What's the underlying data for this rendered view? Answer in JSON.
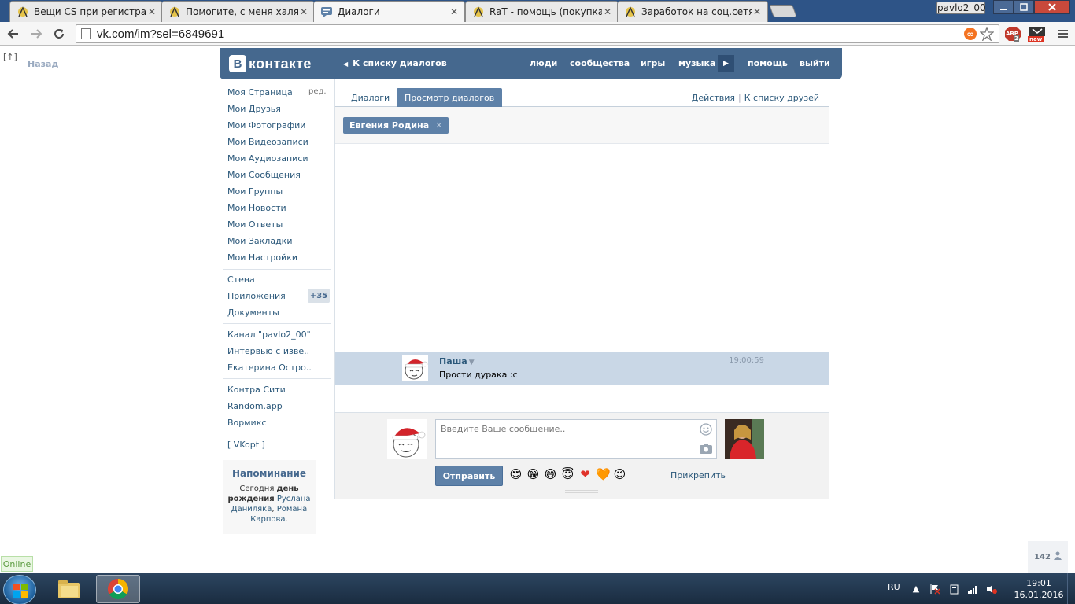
{
  "browser": {
    "tabs": [
      {
        "title": "Вещи CS при регистраци",
        "active": false
      },
      {
        "title": "Помогите, с меня халява",
        "active": false
      },
      {
        "title": "Диалоги",
        "active": true
      },
      {
        "title": "RaT - помощь (покупка-о",
        "active": false
      },
      {
        "title": "Заработок на соц.сетях и",
        "active": false
      }
    ],
    "close_glyph": "✕",
    "profile_name": "pavlo2_00",
    "url": "vk.com/im?sel=6849691",
    "extensions": {
      "abp_label": "ABP",
      "abp_count": "2",
      "new_label": "new"
    }
  },
  "vk": {
    "logo_letter": "В",
    "logo_text": "контакте",
    "back_to_list": "К списку диалогов",
    "topnav": [
      "люди",
      "сообщества",
      "игры",
      "музыка",
      "помощь",
      "выйти"
    ],
    "up_arrow": "[↑]",
    "back_label": "Назад",
    "left_menu": {
      "edit_label": "ред.",
      "group1": [
        "Моя Страница",
        "Мои Друзья",
        "Мои Фотографии",
        "Мои Видеозаписи",
        "Мои Аудиозаписи",
        "Мои Сообщения",
        "Мои Группы",
        "Мои Новости",
        "Мои Ответы",
        "Мои Закладки",
        "Мои Настройки"
      ],
      "group2": [
        "Стена",
        "Приложения",
        "Документы"
      ],
      "apps_badge": "+35",
      "group3": [
        "Канал \"pavlo2_00\"",
        "Интервью с изве..",
        "Екатерина Остро.."
      ],
      "group4": [
        "Контра Сити",
        "Random.app",
        "Вормикс"
      ],
      "group5": [
        "[ VKopt ]"
      ]
    },
    "reminder": {
      "title": "Напоминание",
      "text_today": "Сегодня",
      "text_bold": "день рождения",
      "name1": "Руслана Даниляка",
      "comma": ",",
      "name2": "Романа Карпова",
      "dot": "."
    },
    "tabs": {
      "dialogs": "Диалоги",
      "view": "Просмотр диалогов"
    },
    "actions": {
      "actions": "Действия",
      "sep": "|",
      "to_friends": "К списку друзей"
    },
    "peer_chip": {
      "name": "Евгения Родина",
      "close": "✕"
    },
    "message": {
      "author": "Паша",
      "arrow": "▼",
      "text": "Прости дурака :c",
      "time": "19:00:59"
    },
    "composer": {
      "placeholder": "Введите Ваше сообщение..",
      "send": "Отправить",
      "emoji": [
        "😍",
        "😁",
        "😅",
        "😇",
        "❤",
        "🧡",
        "😉"
      ],
      "attach": "Прикрепить"
    },
    "online": "Online",
    "online_counter": "142"
  },
  "taskbar": {
    "lang": "RU",
    "time": "19:01",
    "date": "16.01.2016"
  },
  "colors": {
    "vk_blue": "#45688e",
    "vk_link": "#2b587a",
    "message_highlight": "#c9d7e6",
    "send_button": "#5e81a8"
  },
  "icons": [
    "back-arrow-icon",
    "forward-arrow-icon",
    "reload-icon",
    "page-icon",
    "infinity-icon",
    "star-icon",
    "menu-icon",
    "smile-icon",
    "camera-icon",
    "person-icon"
  ]
}
